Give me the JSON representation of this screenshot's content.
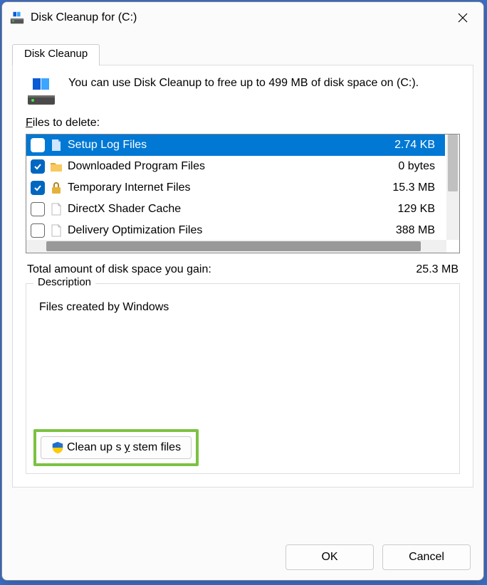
{
  "title": "Disk Cleanup for  (C:)",
  "tab_label": "Disk Cleanup",
  "summary": "You can use Disk Cleanup to free up to 499 MB of disk space on  (C:).",
  "files_label_prefix": "F",
  "files_label_rest": "iles to delete:",
  "files": [
    {
      "name": "Setup Log Files",
      "size": "2.74 KB",
      "checked": false,
      "selected": true,
      "icon": "doc-blue"
    },
    {
      "name": "Downloaded Program Files",
      "size": "0 bytes",
      "checked": true,
      "selected": false,
      "icon": "folder"
    },
    {
      "name": "Temporary Internet Files",
      "size": "15.3 MB",
      "checked": true,
      "selected": false,
      "icon": "lock"
    },
    {
      "name": "DirectX Shader Cache",
      "size": "129 KB",
      "checked": false,
      "selected": false,
      "icon": "doc"
    },
    {
      "name": "Delivery Optimization Files",
      "size": "388 MB",
      "checked": false,
      "selected": false,
      "icon": "doc"
    }
  ],
  "total_label": "Total amount of disk space you gain:",
  "total_value": "25.3 MB",
  "desc_legend": "Description",
  "desc_text": "Files created by Windows",
  "sys_btn_prefix": "Clean up s",
  "sys_btn_ul": "y",
  "sys_btn_rest": "stem files",
  "ok_label": "OK",
  "cancel_label": "Cancel"
}
